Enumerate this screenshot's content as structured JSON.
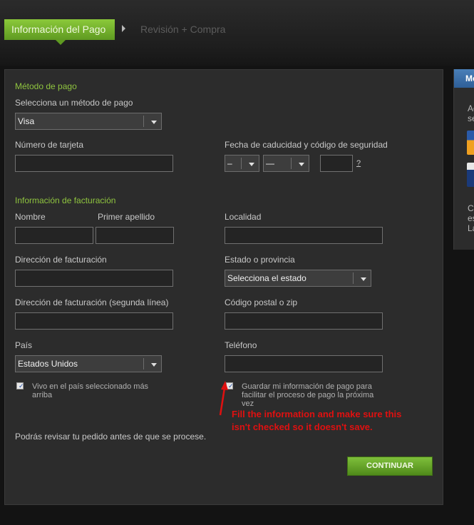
{
  "steps": {
    "active": "Información del Pago",
    "inactive": "Revisión + Compra"
  },
  "payment": {
    "section_title": "Método de pago",
    "method_label": "Selecciona un método de pago",
    "method_value": "Visa",
    "card_number_label": "Número de tarjeta",
    "expiry_label": "Fecha de caducidad y código de seguridad",
    "expiry_month_value": "–",
    "expiry_year_value": "—",
    "cvv_help": "?"
  },
  "billing": {
    "section_title": "Información de facturación",
    "first_name_label": "Nombre",
    "last_name_label": "Primer apellido",
    "city_label": "Localidad",
    "address_label": "Dirección de facturación",
    "state_label": "Estado o provincia",
    "state_value": "Selecciona el estado",
    "address2_label": "Dirección de facturación (segunda línea)",
    "zip_label": "Código postal o zip",
    "country_label": "País",
    "country_value": "Estados Unidos",
    "phone_label": "Teléfono",
    "live_in_country_label": "Vivo en el país seleccionado más arriba",
    "save_info_label": "Guardar mi información de pago para facilitar el proceso de pago la próxima vez",
    "checkbox_mark": "✓"
  },
  "annotation": {
    "text_line1": "Fill the information and make sure this",
    "text_line2": "isn't checked so it doesn't save.",
    "color": "#e01010"
  },
  "review_note": "Podrás revisar tu pedido antes de que se procese.",
  "continue_label": "CONTINUAR",
  "side_panel": {
    "header": "Me",
    "text1": "Ac\nse",
    "text2": "C\nes\nLa"
  },
  "colors": {
    "accent_green": "#8fc43f",
    "panel_bg": "#2c2c2c"
  }
}
